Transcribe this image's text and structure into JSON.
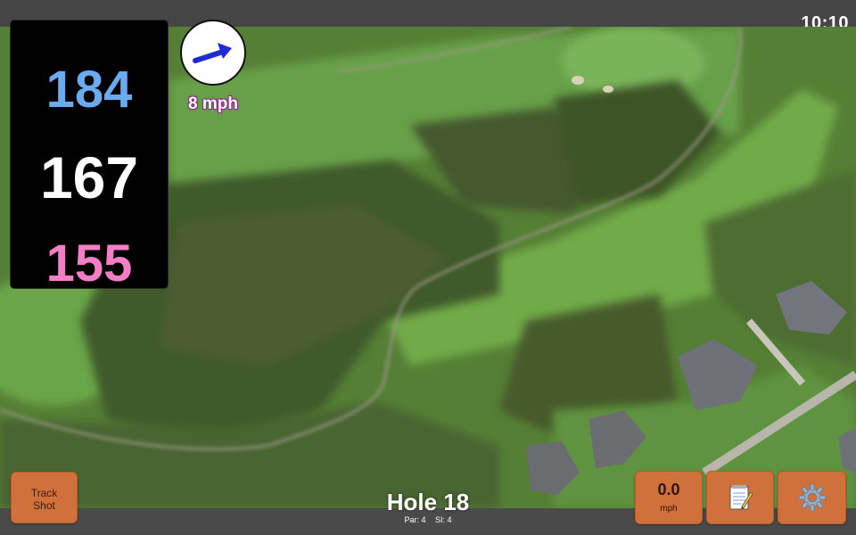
{
  "status": {
    "time": "10:10"
  },
  "distances": {
    "back": "184",
    "middle": "167",
    "front": "155"
  },
  "wind": {
    "speed": "8 mph",
    "icon": "wind-direction-arrow-icon"
  },
  "buttons": {
    "track_shot_line1": "Track",
    "track_shot_line2": "Shot",
    "speed_value": "0.0",
    "speed_unit": "mph",
    "notes_icon": "notepad-icon",
    "settings_icon": "gear-icon"
  },
  "hole": {
    "title": "Hole 18",
    "par": "Par: 4",
    "si": "SI: 4"
  },
  "colors": {
    "back": "#6aaaf0",
    "middle": "#ffffff",
    "front": "#f47ec6",
    "button": "#d0703a"
  }
}
